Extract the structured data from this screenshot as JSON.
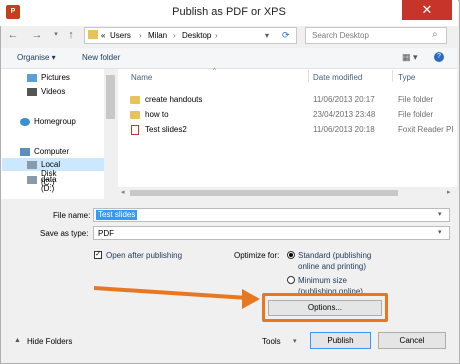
{
  "window": {
    "title": "Publish as PDF or XPS",
    "app_icon": "P",
    "close": "✕"
  },
  "address": {
    "prefix": "«",
    "crumbs": [
      "Users",
      "Milan",
      "Desktop"
    ],
    "sep": "›"
  },
  "search": {
    "placeholder": "Search Desktop"
  },
  "toolbar": {
    "organise": "Organise ▾",
    "new_folder": "New folder",
    "help": "?"
  },
  "nav": {
    "items": [
      "Pictures",
      "Videos",
      "Homegroup",
      "Computer",
      "Local Disk (C:)",
      "data (D:)"
    ]
  },
  "columns": {
    "name": "Name",
    "date": "Date modified",
    "type": "Type"
  },
  "files": [
    {
      "name": "create handouts",
      "date": "11/06/2013 20:17",
      "type": "File folder"
    },
    {
      "name": "how to",
      "date": "23/04/2013 23:48",
      "type": "File folder"
    },
    {
      "name": "Test slides2",
      "date": "11/06/2013 20:18",
      "type": "Foxit Reader PI"
    }
  ],
  "form": {
    "file_name_label": "File name:",
    "file_name_value": "Test slides",
    "save_as_label": "Save as type:",
    "save_as_value": "PDF",
    "open_after": "Open after publishing",
    "optimize_label": "Optimize for:",
    "standard_line1": "Standard (publishing",
    "standard_line2": "online and printing)",
    "minimum_line1": "Minimum size",
    "minimum_line2": "(publishing online)",
    "options": "Options..."
  },
  "footer": {
    "hide_folders": "Hide Folders",
    "tools": "Tools",
    "publish": "Publish",
    "cancel": "Cancel"
  },
  "colors": {
    "highlight": "#e87722",
    "accent": "#3399ff"
  }
}
